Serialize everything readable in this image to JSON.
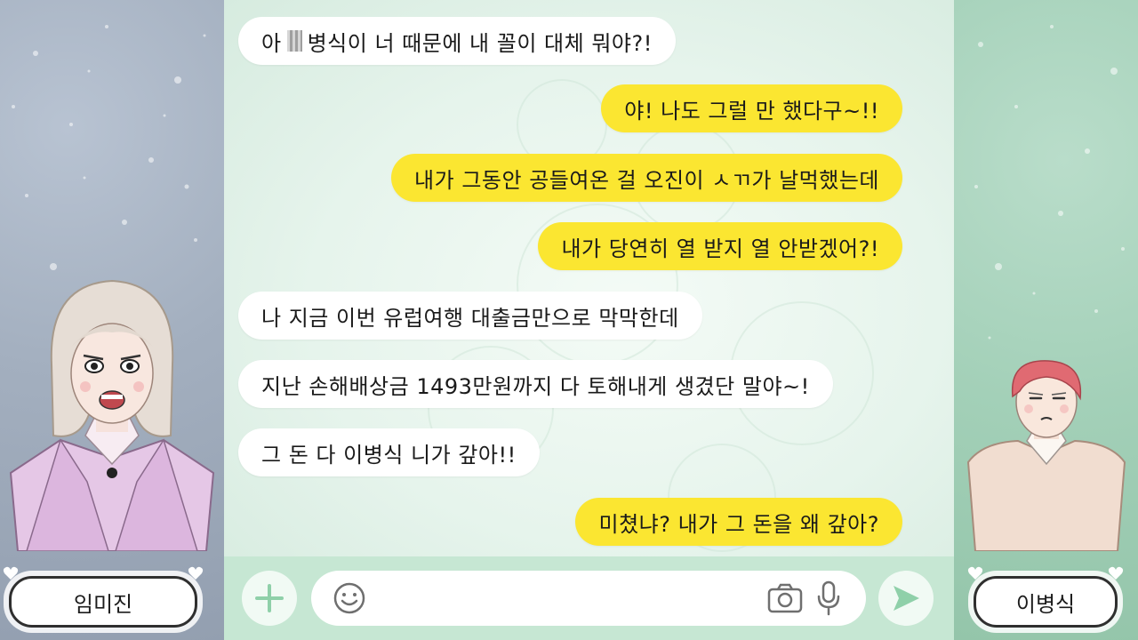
{
  "left_profile": {
    "name": "임미진"
  },
  "right_profile": {
    "name": "이병식"
  },
  "messages": [
    {
      "side": "in",
      "pre": "아",
      "post": "병식이 너 때문에 내 꼴이 대체 뭐야?!"
    },
    {
      "side": "out",
      "text": "야! 나도 그럴 만 했다구~!!"
    },
    {
      "side": "out",
      "text": "내가 그동안 공들여온 걸 오진이 ㅅㄲ가 날먹했는데"
    },
    {
      "side": "out",
      "text": "내가 당연히 열 받지 열 안받겠어?!"
    },
    {
      "side": "in",
      "text": "나 지금 이번 유럽여행 대출금만으로 막막한데"
    },
    {
      "side": "in",
      "text": "지난 손해배상금 1493만원까지 다 토해내게 생겼단 말야~!"
    },
    {
      "side": "in",
      "text": "그 돈 다 이병식 니가 갚아!!"
    },
    {
      "side": "out",
      "text": "미쳤냐? 내가 그 돈을 왜 갚아?"
    }
  ],
  "input": {
    "value": "",
    "placeholder": ""
  },
  "colors": {
    "outgoing_bubble": "#fbe631",
    "incoming_bubble": "#ffffff",
    "input_bar": "#c6e7d3",
    "icon": "#6f6f6f"
  },
  "icons": [
    "plus-icon",
    "emoji-icon",
    "camera-icon",
    "microphone-icon",
    "send-icon"
  ]
}
